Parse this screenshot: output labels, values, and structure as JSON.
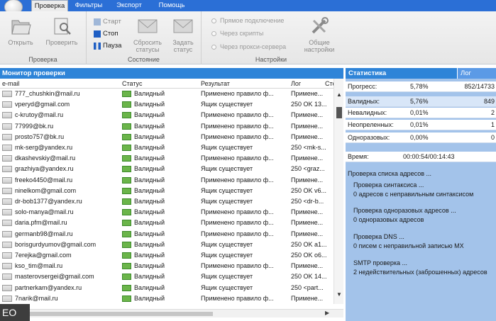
{
  "ribbon": {
    "tabs": [
      {
        "label": "Проверка",
        "active": true
      },
      {
        "label": "Фильтры",
        "active": false
      },
      {
        "label": "Экспорт",
        "active": false
      },
      {
        "label": "Помощь",
        "active": false
      }
    ],
    "buttons": {
      "open": "Открыть",
      "check": "Проверить",
      "start": "Старт",
      "stop": "Стоп",
      "pause": "Пауза",
      "reset": "Сбросить статусы",
      "set_status": "Задать статус",
      "settings": "Общие настройки"
    },
    "radios": {
      "direct": "Прямое подключение",
      "scripts": "Через скрипты",
      "proxy": "Через прокси-сервера"
    },
    "groups": {
      "check": "Проверка",
      "state": "Состояние",
      "settings": "Настройки"
    }
  },
  "monitor": {
    "title": "Монитор проверки",
    "columns": [
      "e-mail",
      "Статус",
      "Результат",
      "Лог",
      "Сте"
    ],
    "rows": [
      {
        "email": "777_chushkin@mail.ru",
        "status": "Валидный",
        "result": "Применено правило ф...",
        "log": "Примене..."
      },
      {
        "email": "vperyd@gmail.com",
        "status": "Валидный",
        "result": "Ящик существует",
        "log": "250 OK 13..."
      },
      {
        "email": "c-krutoy@mail.ru",
        "status": "Валидный",
        "result": "Применено правило ф...",
        "log": "Примене..."
      },
      {
        "email": "77999@bk.ru",
        "status": "Валидный",
        "result": "Применено правило ф...",
        "log": "Примене..."
      },
      {
        "email": "prosto757@bk.ru",
        "status": "Валидный",
        "result": "Применено правило ф...",
        "log": "Примене..."
      },
      {
        "email": "mk-serg@yandex.ru",
        "status": "Валидный",
        "result": "Ящик существует",
        "log": "250 <mk-s..."
      },
      {
        "email": "dkashevskiy@mail.ru",
        "status": "Валидный",
        "result": "Применено правило ф...",
        "log": "Примене..."
      },
      {
        "email": "grazhiya@yandex.ru",
        "status": "Валидный",
        "result": "Ящик существует",
        "log": "250 <graz..."
      },
      {
        "email": "freeko4450@mail.ru",
        "status": "Валидный",
        "result": "Применено правило ф...",
        "log": "Примене..."
      },
      {
        "email": "ninelkom@gmail.com",
        "status": "Валидный",
        "result": "Ящик существует",
        "log": "250 OK v6..."
      },
      {
        "email": "dr-bob1377@yandex.ru",
        "status": "Валидный",
        "result": "Ящик существует",
        "log": "250 <dr-b..."
      },
      {
        "email": "solo-manya@mail.ru",
        "status": "Валидный",
        "result": "Применено правило ф...",
        "log": "Примене..."
      },
      {
        "email": "daria.pfm@mail.ru",
        "status": "Валидный",
        "result": "Применено правило ф...",
        "log": "Примене..."
      },
      {
        "email": "germanb98@mail.ru",
        "status": "Валидный",
        "result": "Применено правило ф...",
        "log": "Примене..."
      },
      {
        "email": "borisgurdyumov@gmail.com",
        "status": "Валидный",
        "result": "Ящик существует",
        "log": "250 OK a1..."
      },
      {
        "email": "7erejka@gmail.com",
        "status": "Валидный",
        "result": "Ящик существует",
        "log": "250 OK o6..."
      },
      {
        "email": "kso_tim@mail.ru",
        "status": "Валидный",
        "result": "Применено правило ф...",
        "log": "Примене..."
      },
      {
        "email": "masterovsergei@gmail.com",
        "status": "Валидный",
        "result": "Ящик существует",
        "log": "250 OK 14..."
      },
      {
        "email": "partnerkam@yandex.ru",
        "status": "Валидный",
        "result": "Ящик существует",
        "log": "250 <part..."
      },
      {
        "email": "7narik@mail.ru",
        "status": "Валидный",
        "result": "Применено правило ф...",
        "log": "Примене..."
      },
      {
        "email": "",
        "status": "",
        "result": "",
        "log": ""
      }
    ]
  },
  "stats": {
    "tab_stats": "Статистика",
    "tab_log": "Лог",
    "rows": [
      {
        "label": "Прогресс:",
        "pct": "5,78%",
        "value": "852/14733"
      },
      {
        "label": "Валидных:",
        "pct": "5,76%",
        "value": "849"
      },
      {
        "label": "Невалидных:",
        "pct": "0,01%",
        "value": "2"
      },
      {
        "label": "Неопреленных:",
        "pct": "0,01%",
        "value": "1"
      },
      {
        "label": "Одноразовых:",
        "pct": "0,00%",
        "value": "0"
      }
    ],
    "time_label": "Время:",
    "time_value": "00:00:54/00:14:43",
    "checks": {
      "list": "Проверка списка адресов ...",
      "syntax": "Проверка синтаксиса ...",
      "syntax_result": "0 адресов с неправильным синтаксисом",
      "disposable": "Проверка одноразовых адресов ...",
      "disposable_result": "0 одноразовых адресов",
      "dns": "Проверка DNS ...",
      "dns_result": "0 писем с неправильной записью MX",
      "smtp": "SMTP проверка ...",
      "smtp_result": "2 недействительных (заброшенных) адресов"
    }
  },
  "watermark": "EO"
}
